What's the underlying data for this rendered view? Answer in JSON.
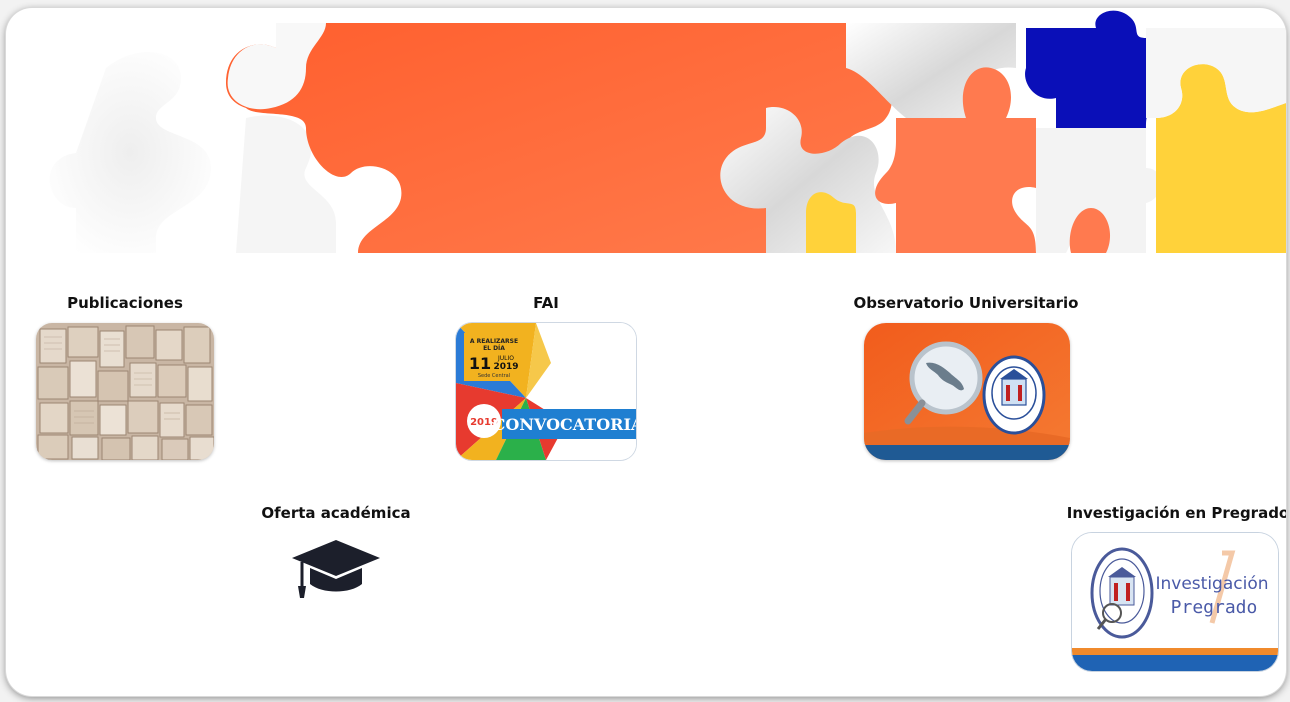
{
  "banner": {
    "colors": {
      "orange": "#ff6633",
      "orange_light": "#ff7a4f",
      "blue": "#0a0fb8",
      "yellow": "#ffd23a",
      "white_piece": "#f4f4f4"
    }
  },
  "sections": {
    "publicaciones": {
      "title": "Publicaciones"
    },
    "fai": {
      "title": "FAI",
      "poster": {
        "line1": "A REALIZARSE",
        "line2": "EL DÍA",
        "day": "11",
        "month": "JULIO",
        "year": "2019",
        "place": "Sede Central",
        "badge": "2019",
        "banner": "CONVOCATORIA"
      }
    },
    "observatorio": {
      "title": "Observatorio Universitario"
    },
    "oferta": {
      "title": "Oferta académica",
      "icon": "graduation-cap-icon"
    },
    "investigacion": {
      "title": "Investigación en Pregrado",
      "logo_line1": "Investigación",
      "logo_line2": "Pregrado"
    }
  }
}
